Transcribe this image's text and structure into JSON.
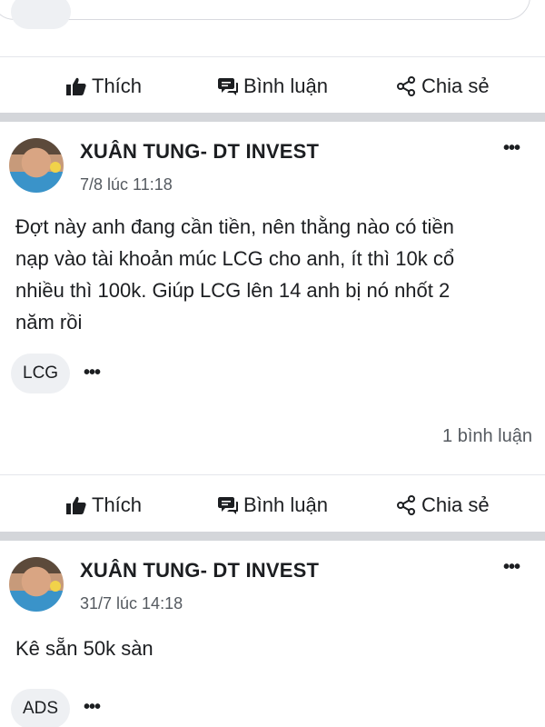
{
  "actions": {
    "like_label": "Thích",
    "comment_label": "Bình luận",
    "share_label": "Chia sẻ"
  },
  "posts": [
    {
      "author": "XUÂN TUNG- DT INVEST",
      "time": "7/8 lúc 11:18",
      "text_lines": [
        "Đợt này anh đang cần tiền, nên thằng nào có tiền",
        "nạp vào tài khoản múc LCG cho anh, ít thì 10k cổ",
        "nhiều thì 100k. Giúp LCG lên 14 anh bị nó nhốt 2",
        "năm rồi"
      ],
      "tag": "LCG",
      "comment_count": "1 bình luận"
    },
    {
      "author": "XUÂN TUNG- DT INVEST",
      "time": "31/7 lúc 14:18",
      "text_lines": [
        "Kê sẵn 50k sàn"
      ],
      "tag": "ADS"
    }
  ],
  "icons": {
    "like": "thumbs-up-icon",
    "comment": "comment-icon",
    "share": "share-icon",
    "more": "more-options-icon"
  },
  "colors": {
    "text": "#1c1e21",
    "secondary_text": "#555a60",
    "separator": "#d4d6da",
    "chip_bg": "#eef0f3"
  }
}
